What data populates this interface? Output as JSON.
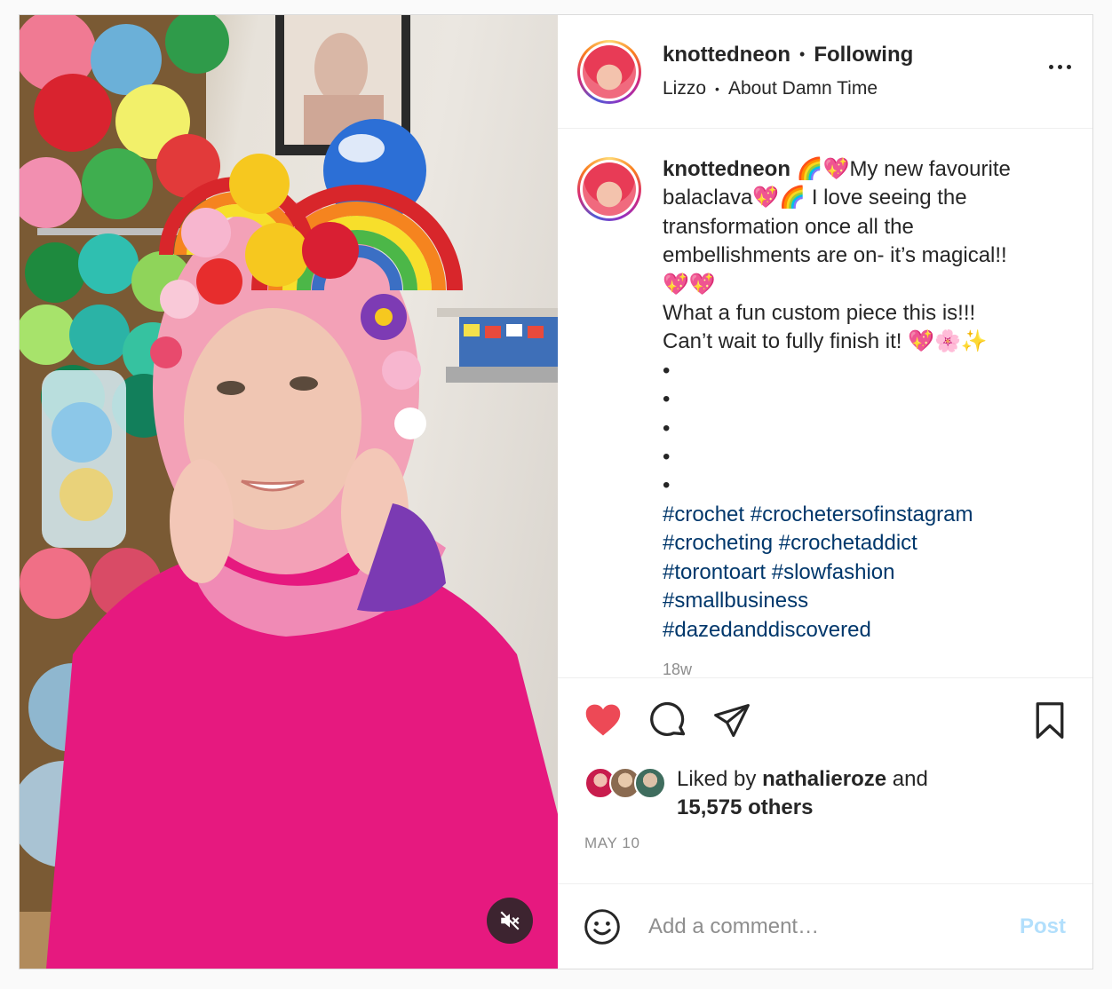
{
  "post": {
    "author": {
      "username": "knottedneon",
      "follow_status": "Following"
    },
    "audio": {
      "artist": "Lizzo",
      "track": "About Damn Time"
    },
    "caption": {
      "text": "🌈💖My new favourite balaclava💖🌈 I love seeing the transformation once all the embellishments are on- it’s magical!!\n💖💖\nWhat a fun custom piece this is!!!\nCan’t wait to fully finish it! 💖🌸✨\n•\n•\n•\n•\n•",
      "hashtags": [
        "#crochet",
        "#crochetersofinstagram",
        "#crocheting",
        "#crochetaddict",
        "#torontoart",
        "#slowfashion",
        "#smallbusiness",
        "#dazedanddiscovered"
      ],
      "time_ago": "18w"
    },
    "likes": {
      "prefix": "Liked by",
      "liked_by_user": "nathalieroze",
      "conjunction": "and",
      "others": "15,575 others"
    },
    "date": "MAY 10",
    "comment_box": {
      "placeholder": "Add a comment…",
      "post_label": "Post"
    },
    "icons": {
      "like": "heart-filled-icon",
      "comment": "comment-bubble-icon",
      "share": "paper-plane-icon",
      "save": "bookmark-icon",
      "emoji": "emoji-smiley-icon",
      "mute": "speaker-muted-icon",
      "more": "more-options-icon"
    },
    "colors": {
      "like_red": "#ed4956",
      "hashtag_blue": "#00376b",
      "secondary_text": "#8e8e8e",
      "post_button_disabled": "#b2dffc"
    }
  }
}
